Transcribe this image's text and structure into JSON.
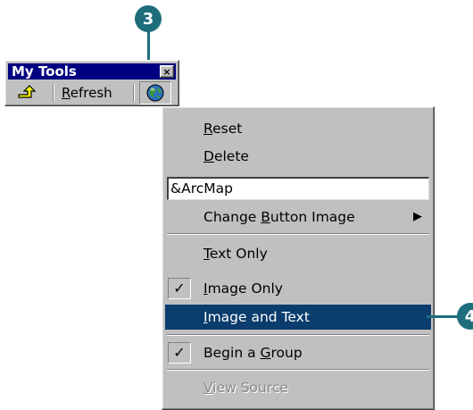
{
  "callouts": {
    "step3": "3",
    "step4": "4",
    "color": "#1e6d7d"
  },
  "toolbar": {
    "title": "My Tools",
    "close_symbol": "×",
    "up_icon": "up-arrow-icon",
    "refresh_mnemonic": "R",
    "refresh_rest": "efresh",
    "globe_icon": "globe-icon"
  },
  "menu": {
    "reset": {
      "mn": "R",
      "rest": "eset"
    },
    "delete": {
      "mn": "D",
      "rest": "elete"
    },
    "name_value": "&ArcMap",
    "change_image": {
      "pre": "Change ",
      "mn": "B",
      "rest": "utton Image"
    },
    "text_only": {
      "mn": "T",
      "rest": "ext Only"
    },
    "image_only": {
      "mn": "I",
      "rest": "mage Only",
      "checked": true
    },
    "image_and_text": {
      "mn": "I",
      "rest": "mage and Text",
      "highlighted": true
    },
    "begin_group": {
      "pre": "Begin a ",
      "mn": "G",
      "rest": "roup",
      "checked": true
    },
    "view_source": {
      "mn": "V",
      "rest": "iew Source",
      "disabled": true
    },
    "highlight_color": "#0a3c6e"
  }
}
